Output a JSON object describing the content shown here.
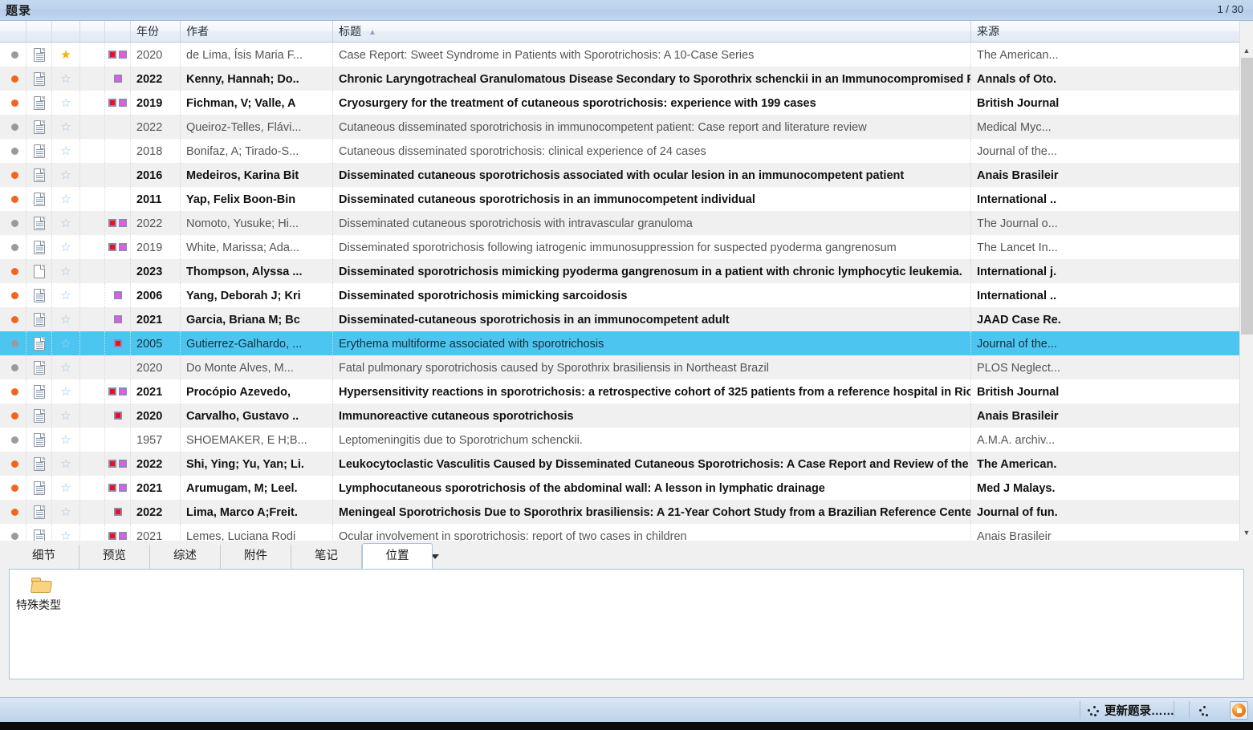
{
  "window": {
    "title": "题录",
    "counter": "1 / 30"
  },
  "columns": {
    "year": "年份",
    "author": "作者",
    "title": "标题",
    "source": "来源",
    "sort_indicator": "▲"
  },
  "rows": [
    {
      "read": "gray",
      "doc": "lined",
      "star": "gold",
      "tags": [
        "red",
        "mag"
      ],
      "year": "2020",
      "author": "de Lima, Ísis Maria F...",
      "title": "Case Report: Sweet Syndrome in Patients with Sporotrichosis: A 10-Case Series",
      "source": "The American...",
      "bold": false,
      "selected": false
    },
    {
      "read": "orange",
      "doc": "lined",
      "star": "empty",
      "tags": [
        "mag"
      ],
      "year": "2022",
      "author": "Kenny, Hannah; Do..",
      "title": "Chronic Laryngotracheal Granulomatous Disease Secondary to Sporothrix schenckii  in an Immunocompromised Patie",
      "source": "Annals of Oto.",
      "bold": true,
      "selected": false
    },
    {
      "read": "orange",
      "doc": "lined",
      "star": "empty",
      "tags": [
        "red",
        "mag"
      ],
      "year": "2019",
      "author": "Fichman, V; Valle, A",
      "title": "Cryosurgery for the treatment of cutaneous sporotrichosis: experience with 199 cases",
      "source": "British Journal",
      "bold": true,
      "selected": false
    },
    {
      "read": "gray",
      "doc": "lined",
      "star": "empty",
      "tags": [],
      "year": "2022",
      "author": "Queiroz-Telles, Flávi...",
      "title": "Cutaneous disseminated sporotrichosis in immunocompetent patient: Case report and literature review",
      "source": "Medical Myc...",
      "bold": false,
      "selected": false
    },
    {
      "read": "gray",
      "doc": "lined",
      "star": "empty",
      "tags": [],
      "year": "2018",
      "author": "Bonifaz, A; Tirado-S...",
      "title": "Cutaneous disseminated sporotrichosis: clinical experience of 24 cases",
      "source": "Journal of the...",
      "bold": false,
      "selected": false
    },
    {
      "read": "orange",
      "doc": "lined",
      "star": "empty",
      "tags": [],
      "year": "2016",
      "author": "Medeiros, Karina Bit",
      "title": "Disseminated cutaneous sporotrichosis associated with ocular lesion in an immunocompetent patient",
      "source": "Anais Brasileir",
      "bold": true,
      "selected": false
    },
    {
      "read": "orange",
      "doc": "lined",
      "star": "empty",
      "tags": [],
      "year": "2011",
      "author": "Yap, Felix Boon-Bin",
      "title": "Disseminated cutaneous sporotrichosis in an immunocompetent individual",
      "source": "International ..",
      "bold": true,
      "selected": false
    },
    {
      "read": "gray",
      "doc": "lined",
      "star": "empty",
      "tags": [
        "red",
        "mag"
      ],
      "year": "2022",
      "author": "Nomoto, Yusuke; Hi...",
      "title": "Disseminated cutaneous sporotrichosis with intravascular granuloma",
      "source": "The Journal o...",
      "bold": false,
      "selected": false
    },
    {
      "read": "gray",
      "doc": "lined",
      "star": "empty",
      "tags": [
        "red",
        "mag"
      ],
      "year": "2019",
      "author": "White, Marissa; Ada...",
      "title": "Disseminated sporotrichosis following iatrogenic immunosuppression for suspected pyoderma gangrenosum",
      "source": "The Lancet In...",
      "bold": false,
      "selected": false
    },
    {
      "read": "orange",
      "doc": "blank",
      "star": "empty",
      "tags": [],
      "year": "2023",
      "author": "Thompson, Alyssa ...",
      "title": "Disseminated sporotrichosis mimicking pyoderma gangrenosum in a patient with chronic lymphocytic leukemia.",
      "source": "International j.",
      "bold": true,
      "selected": false
    },
    {
      "read": "orange",
      "doc": "lined",
      "star": "empty",
      "tags": [
        "mag"
      ],
      "year": "2006",
      "author": "Yang, Deborah J; Kri",
      "title": "Disseminated sporotrichosis mimicking sarcoidosis",
      "source": "International ..",
      "bold": true,
      "selected": false
    },
    {
      "read": "orange",
      "doc": "lined",
      "star": "empty",
      "tags": [
        "mag"
      ],
      "year": "2021",
      "author": "Garcia, Briana M; Bc",
      "title": "Disseminated-cutaneous sporotrichosis in an immunocompetent adult",
      "source": "JAAD Case Re.",
      "bold": true,
      "selected": false
    },
    {
      "read": "gray",
      "doc": "lined",
      "star": "empty",
      "tags": [
        "red"
      ],
      "year": "2005",
      "author": "Gutierrez-Galhardo, ...",
      "title": "Erythema multiforme associated with sporotrichosis",
      "source": "Journal of the...",
      "bold": false,
      "selected": true
    },
    {
      "read": "gray",
      "doc": "lined",
      "star": "empty",
      "tags": [],
      "year": "2020",
      "author": "Do Monte Alves, M...",
      "title": "Fatal pulmonary sporotrichosis caused by Sporothrix brasiliensis in Northeast Brazil",
      "source": "PLOS Neglect...",
      "bold": false,
      "selected": false
    },
    {
      "read": "orange",
      "doc": "lined",
      "star": "empty",
      "tags": [
        "red",
        "mag"
      ],
      "year": "2021",
      "author": "Procópio Azevedo,",
      "title": "Hypersensitivity reactions in sporotrichosis: a retrospective cohort of 325 patients from a reference hospital in Rio de",
      "source": "British Journal",
      "bold": true,
      "selected": false
    },
    {
      "read": "orange",
      "doc": "lined",
      "star": "empty",
      "tags": [
        "red"
      ],
      "year": "2020",
      "author": "Carvalho, Gustavo ..",
      "title": "Immunoreactive cutaneous sporotrichosis",
      "source": "Anais Brasileir",
      "bold": true,
      "selected": false
    },
    {
      "read": "gray",
      "doc": "lined",
      "star": "empty",
      "tags": [],
      "year": "1957",
      "author": "SHOEMAKER, E H;B...",
      "title": "Leptomeningitis due to Sporotrichum schenckii.",
      "source": "A.M.A. archiv...",
      "bold": false,
      "selected": false
    },
    {
      "read": "orange",
      "doc": "lined",
      "star": "empty",
      "tags": [
        "red",
        "mag"
      ],
      "year": "2022",
      "author": "Shi, Ying; Yu, Yan; Li.",
      "title": "Leukocytoclastic Vasculitis Caused by Disseminated Cutaneous Sporotrichosis: A Case Report and Review of the Literat",
      "source": "The American.",
      "bold": true,
      "selected": false
    },
    {
      "read": "orange",
      "doc": "lined",
      "star": "empty",
      "tags": [
        "red",
        "mag"
      ],
      "year": "2021",
      "author": "Arumugam, M; Leel.",
      "title": "Lymphocutaneous sporotrichosis of the abdominal wall: A lesson in lymphatic drainage",
      "source": "Med J Malays.",
      "bold": true,
      "selected": false
    },
    {
      "read": "orange",
      "doc": "lined",
      "star": "empty",
      "tags": [
        "red"
      ],
      "year": "2022",
      "author": "Lima, Marco A;Freit.",
      "title": "Meningeal Sporotrichosis Due to Sporothrix brasiliensis: A 21-Year Cohort Study from a Brazilian Reference Center.",
      "source": "Journal of fun.",
      "bold": true,
      "selected": false
    },
    {
      "read": "gray",
      "doc": "lined",
      "star": "empty",
      "tags": [
        "red",
        "mag"
      ],
      "year": "2021",
      "author": "Lemes, Luciana Rodi",
      "title": "Ocular involvement in sporotrichosis: report of two cases in children",
      "source": "Anais Brasileir",
      "bold": false,
      "selected": false
    }
  ],
  "tabs": [
    {
      "label": "细节",
      "active": false
    },
    {
      "label": "预览",
      "active": false
    },
    {
      "label": "综述",
      "active": false
    },
    {
      "label": "附件",
      "active": false
    },
    {
      "label": "笔记",
      "active": false
    },
    {
      "label": "位置",
      "active": true
    }
  ],
  "panel": {
    "folder_label": "特殊类型"
  },
  "status": {
    "message": "更新题录……"
  },
  "colors": {
    "selection": "#4cc6f0",
    "unread_dot": "#f0661e",
    "read_dot": "#9a9a9a",
    "star_gold": "#f5b400",
    "star_empty": "#9dc0e2",
    "tag_red": "#ee1111",
    "tag_magenta": "#ee55ee",
    "titlebar": "#bcd4ec"
  }
}
